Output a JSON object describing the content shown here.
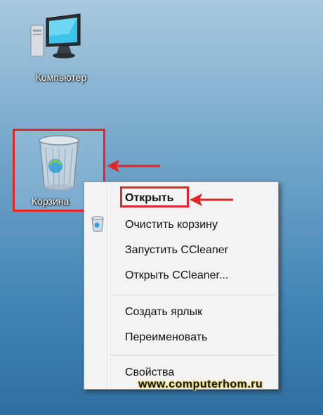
{
  "desktop": {
    "computer_label": "Компьютер",
    "recycle_bin_label": "Корзина"
  },
  "context_menu": {
    "items": [
      {
        "label": "Открыть",
        "bold": true
      },
      {
        "label": "Очистить корзину",
        "icon": "recycle-bin-icon"
      },
      {
        "label": "Запустить CCleaner"
      },
      {
        "label": "Открыть CCleaner..."
      },
      {
        "label": "Создать ярлык"
      },
      {
        "label": "Переименовать"
      },
      {
        "label": "Свойства"
      }
    ]
  },
  "watermark": "www.computerhom.ru",
  "colors": {
    "highlight": "#e32626",
    "menu_bg": "#f3f3f3"
  }
}
